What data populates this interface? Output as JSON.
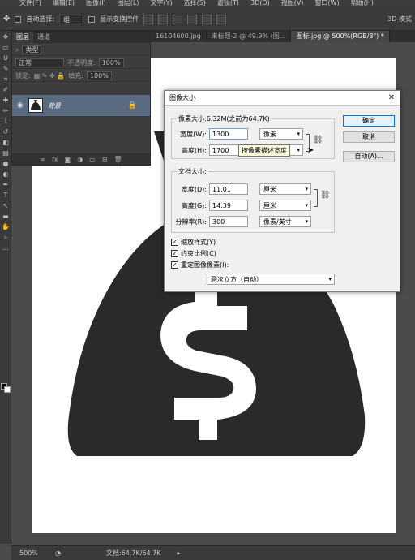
{
  "menubar": {
    "items": [
      "文件(F)",
      "编辑(E)",
      "图像(I)",
      "图层(L)",
      "文字(Y)",
      "选择(S)",
      "滤镜(T)",
      "3D(D)",
      "视图(V)",
      "窗口(W)",
      "帮助(H)"
    ]
  },
  "options": {
    "auto_select_label": "自动选择:",
    "auto_select_value": "组",
    "show_transform_label": "显示变换控件",
    "mode_3d": "3D 模式"
  },
  "tabs": [
    "16104600.jpg",
    "未标题-2 @ 49.9% (图...",
    "图标.jpg @ 500%(RGB/8\") *"
  ],
  "layers_panel": {
    "tab1": "图层",
    "tab2": "通道",
    "filter_label": "类型",
    "blend_mode": "正常",
    "opacity_label": "不透明度:",
    "opacity_value": "100%",
    "lock_label": "锁定:",
    "fill_label": "填充:",
    "fill_value": "100%",
    "layer_name": "背景"
  },
  "status": {
    "zoom": "500%",
    "doc_info": "文档:64.7K/64.7K"
  },
  "dialog": {
    "title": "图像大小",
    "pixel_group_label": "像素大小:6.32M(之前为64.7K)",
    "pixel_width_label": "宽度(W):",
    "pixel_width_value": "1300",
    "pixel_width_unit": "像素",
    "pixel_height_label": "高度(H):",
    "pixel_height_value": "1700",
    "pixel_height_unit": "像素",
    "tooltip": "按像素描述宽度",
    "doc_group_label": "文档大小:",
    "doc_width_label": "宽度(D):",
    "doc_width_value": "11.01",
    "doc_width_unit": "厘米",
    "doc_height_label": "高度(G):",
    "doc_height_value": "14.39",
    "doc_height_unit": "厘米",
    "resolution_label": "分辨率(R):",
    "resolution_value": "300",
    "resolution_unit": "像素/英寸",
    "scale_styles_label": "缩放样式(Y)",
    "constrain_label": "约束比例(C)",
    "resample_label": "重定图像像素(I):",
    "resample_method": "两次立方（自动）",
    "ok_label": "确定",
    "cancel_label": "取消",
    "auto_label": "自动(A)..."
  }
}
